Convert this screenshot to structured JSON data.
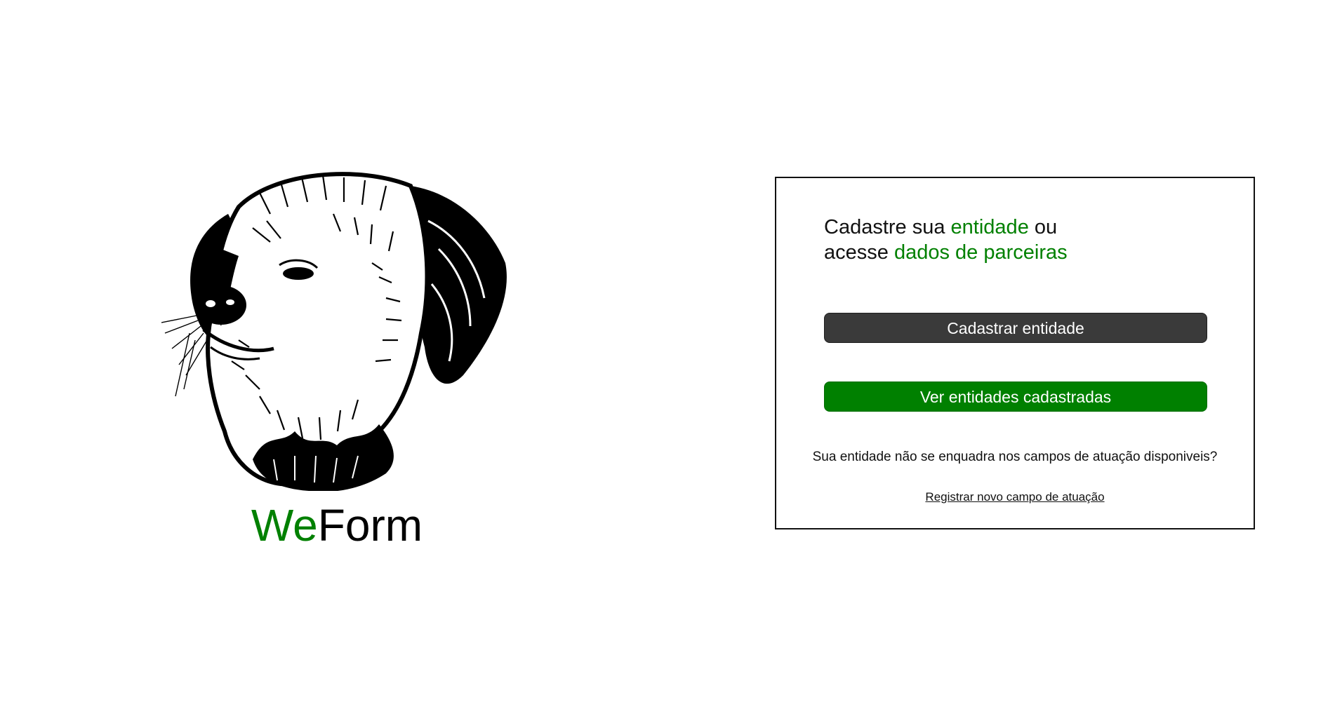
{
  "brand": {
    "illustration": "dog-head-sketch-icon",
    "logo_prefix": "We",
    "logo_suffix": "Form",
    "accent_color": "#008000"
  },
  "card": {
    "headline": {
      "line1_before": "Cadastre sua ",
      "line1_accent": "entidade",
      "line1_after": " ou",
      "line2_before": "acesse ",
      "line2_accent": "dados de parceiras"
    },
    "register_button_label": "Cadastrar entidade",
    "view_button_label": "Ver entidades cadastradas",
    "question_text": "Sua entidade não se enquadra nos campos de atuação disponiveis?",
    "register_field_link": "Registrar novo campo de atuação",
    "colors": {
      "primary_dark": "#3a3a3a",
      "primary_green": "#008000",
      "border": "#111111"
    }
  }
}
